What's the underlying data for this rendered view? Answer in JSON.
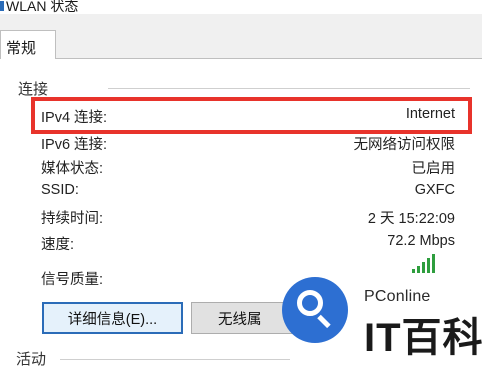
{
  "window": {
    "title": "WLAN 状态"
  },
  "tabs": [
    {
      "label": "常规"
    }
  ],
  "connection": {
    "group_label": "连接",
    "rows": [
      {
        "label": "IPv4 连接:",
        "value": "Internet"
      },
      {
        "label": "IPv6 连接:",
        "value": "无网络访问权限"
      },
      {
        "label": "媒体状态:",
        "value": "已启用"
      },
      {
        "label": "SSID:",
        "value": "GXFC"
      },
      {
        "label": "持续时间:",
        "value": "2 天 15:22:09"
      },
      {
        "label": "速度:",
        "value": "72.2 Mbps"
      },
      {
        "label": "信号质量:",
        "value": ""
      }
    ],
    "signal_bars": 5,
    "signal_level": 5
  },
  "buttons": {
    "details": "详细信息(E)...",
    "wireless": "无线属"
  },
  "activity": {
    "group_label": "活动"
  },
  "watermark": {
    "brand": "PConline",
    "logo": "IT百科"
  },
  "colors": {
    "highlight": "#e8332b",
    "accent": "#2b6cb8",
    "signal": "#2e9e3e",
    "watermark": "#2d6fd2"
  }
}
